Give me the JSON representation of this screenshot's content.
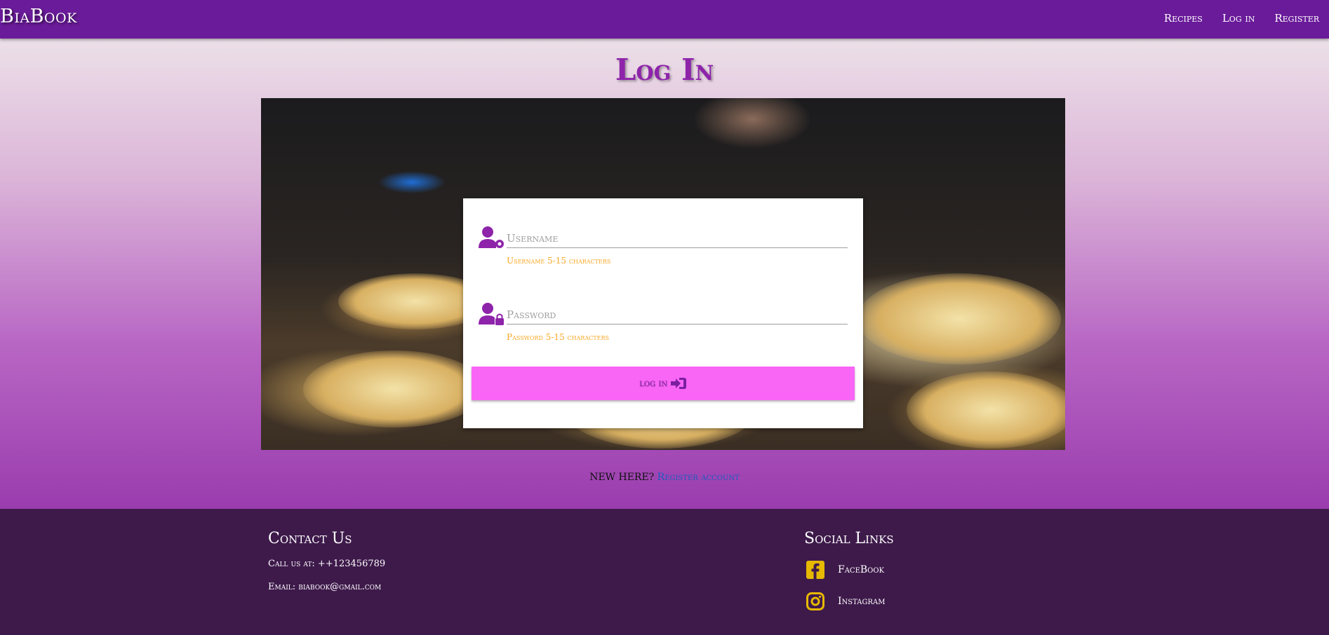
{
  "navbar": {
    "brand": "BiaBook",
    "links": [
      {
        "label": "Recipes"
      },
      {
        "label": "Log in"
      },
      {
        "label": "Register"
      }
    ]
  },
  "main": {
    "title": "Log In",
    "form": {
      "username": {
        "placeholder": "Username",
        "value": "",
        "help": "Username 5-15 characters",
        "icon": "user-cog-icon"
      },
      "password": {
        "placeholder": "Password",
        "value": "",
        "help": "Password 5-15 characters",
        "icon": "user-lock-icon"
      },
      "submit_label": "log in",
      "submit_icon": "sign-in-icon"
    },
    "register_prompt": "NEW HERE?",
    "register_link": "Register account"
  },
  "footer": {
    "contact_title": "Contact Us",
    "phone": "Call us at: ++123456789",
    "email": "Email: biabook@gmail.com",
    "social_title": "Social Links",
    "social": [
      {
        "label": "FaceBook",
        "icon": "facebook-icon"
      },
      {
        "label": "Instagram",
        "icon": "instagram-icon"
      }
    ]
  },
  "colors": {
    "navbar": "#6a1b9a",
    "title": "#8e24aa",
    "button": "#f965f5",
    "help_text": "#f9a825",
    "footer": "#3e1a4b",
    "social_icon": "#e6b800",
    "link": "#1e5bbf"
  }
}
